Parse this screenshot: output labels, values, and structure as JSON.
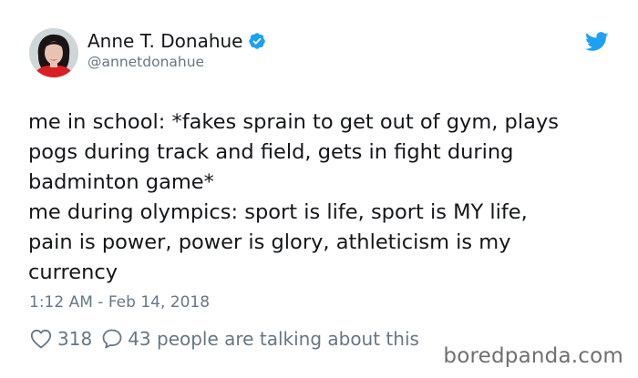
{
  "author": {
    "display_name": "Anne T. Donahue",
    "handle": "@annetdonahue",
    "verified": true
  },
  "tweet": {
    "lines": [
      "me in school: *fakes sprain to get out of gym, plays",
      "pogs during track and field, gets in fight during",
      "badminton game*",
      "me during olympics: sport is life, sport is MY life,",
      "pain is power, power is glory, athleticism is my",
      "currency"
    ],
    "timestamp": "1:12 AM - Feb 14, 2018"
  },
  "stats": {
    "likes": "318",
    "talking": "43 people are talking about this"
  },
  "icons": {
    "brand": "twitter-bird-icon",
    "verified": "verified-badge-icon",
    "like": "heart-outline-icon",
    "reply": "speech-bubble-icon"
  },
  "colors": {
    "twitter_blue": "#1da1f2",
    "secondary_text": "#657786",
    "primary_text": "#14171a"
  },
  "watermark": "boredpanda.com"
}
